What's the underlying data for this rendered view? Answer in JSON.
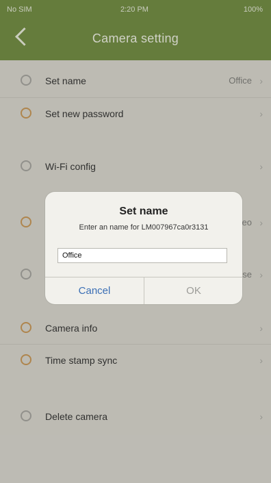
{
  "status_bar": {
    "carrier": "No SIM",
    "time": "2:20 PM",
    "battery": "100%"
  },
  "nav": {
    "title": "Camera setting"
  },
  "settings": {
    "set_name": {
      "label": "Set name",
      "value": "Office"
    },
    "set_password": {
      "label": "Set new password"
    },
    "wifi": {
      "label": "Wi-Fi config"
    },
    "row4_partial_value": "eo",
    "row5_partial_value": "se",
    "camera_info": {
      "label": "Camera info"
    },
    "time_sync": {
      "label": "Time stamp sync"
    },
    "delete": {
      "label": "Delete camera"
    }
  },
  "dialog": {
    "title": "Set name",
    "message": "Enter an name for LM007967ca0r3131",
    "input_value": "Office",
    "cancel_label": "Cancel",
    "ok_label": "OK"
  },
  "colors": {
    "header": "#6e8a3e",
    "accent_link": "#3b6fb5"
  }
}
